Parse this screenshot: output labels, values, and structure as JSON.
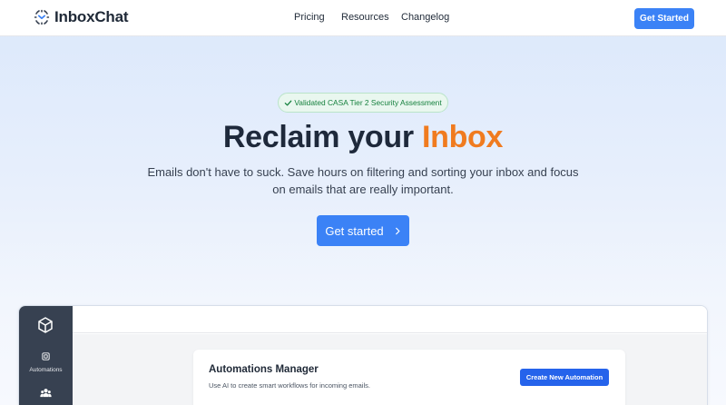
{
  "header": {
    "brand": "InboxChat",
    "nav": [
      "Pricing",
      "Resources",
      "Changelog"
    ],
    "cta_label": "Get Started"
  },
  "hero": {
    "badge_text": "Validated CASA Tier 2 Security Assessment",
    "title_main": "Reclaim your ",
    "title_accent": "Inbox",
    "subtitle": "Emails don't have to suck. Save hours on filtering and sorting your inbox and focus on emails that are really important.",
    "cta_label": "Get started"
  },
  "app_preview": {
    "sidebar": {
      "items": [
        {
          "label": "Automations",
          "icon": "chip-icon"
        },
        {
          "label": "",
          "icon": "users-icon"
        }
      ]
    },
    "card": {
      "title": "Automations Manager",
      "description": "Use AI to create smart workflows for incoming emails.",
      "button_label": "Create New Automation"
    }
  },
  "colors": {
    "primary": "#3b82f6",
    "accent": "#f07b1f",
    "sidebar": "#374151",
    "badge_green": "#15803d"
  }
}
